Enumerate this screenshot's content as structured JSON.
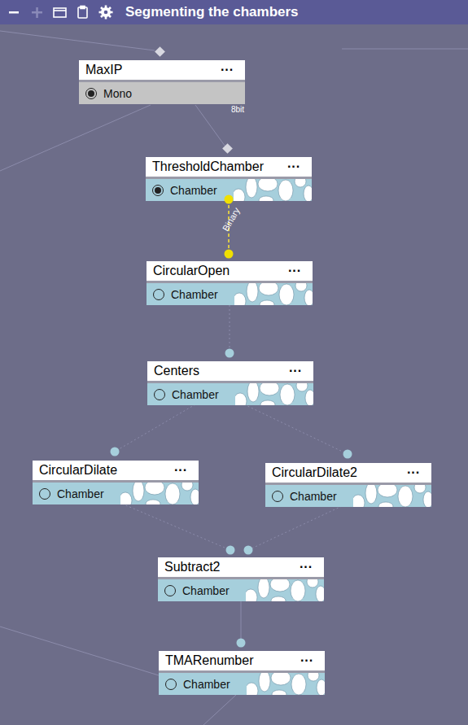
{
  "window": {
    "title": "Segmenting the chambers"
  },
  "toolbar": [
    {
      "name": "zoom-out",
      "disabled": false
    },
    {
      "name": "zoom-in",
      "disabled": true
    },
    {
      "name": "folder",
      "disabled": false
    },
    {
      "name": "clipboard",
      "disabled": false
    },
    {
      "name": "settings",
      "disabled": false
    }
  ],
  "nodes": [
    {
      "name": "MaxIP",
      "more": "···",
      "channel": "Mono",
      "selected": true,
      "kind": "mono",
      "badge": "8bit"
    },
    {
      "name": "ThresholdChamber",
      "more": "···",
      "channel": "Chamber",
      "selected": true,
      "kind": "chamber",
      "badge": ""
    },
    {
      "name": "CircularOpen",
      "more": "···",
      "channel": "Chamber",
      "selected": false,
      "kind": "chamber",
      "badge": ""
    },
    {
      "name": "Centers",
      "more": "···",
      "channel": "Chamber",
      "selected": false,
      "kind": "chamber",
      "badge": ""
    },
    {
      "name": "CircularDilate",
      "more": "···",
      "channel": "Chamber",
      "selected": false,
      "kind": "chamber",
      "badge": ""
    },
    {
      "name": "CircularDilate2",
      "more": "···",
      "channel": "Chamber",
      "selected": false,
      "kind": "chamber",
      "badge": ""
    },
    {
      "name": "Subtract2",
      "more": "···",
      "channel": "Chamber",
      "selected": false,
      "kind": "chamber",
      "badge": ""
    },
    {
      "name": "TMARenumber",
      "more": "···",
      "channel": "Chamber",
      "selected": false,
      "kind": "chamber",
      "badge": ""
    }
  ],
  "edge_label": "Binary"
}
